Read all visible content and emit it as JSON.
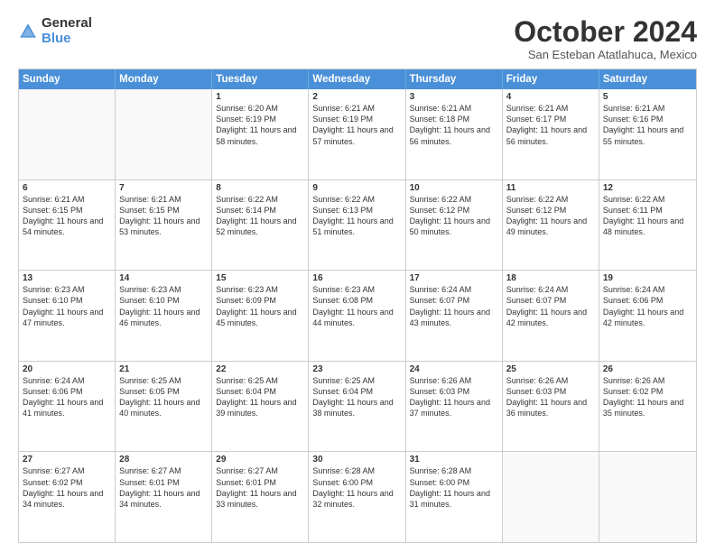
{
  "logo": {
    "general": "General",
    "blue": "Blue"
  },
  "title": "October 2024",
  "location": "San Esteban Atatlahuca, Mexico",
  "header_days": [
    "Sunday",
    "Monday",
    "Tuesday",
    "Wednesday",
    "Thursday",
    "Friday",
    "Saturday"
  ],
  "weeks": [
    [
      {
        "day": "",
        "empty": true
      },
      {
        "day": "",
        "empty": true
      },
      {
        "day": "1",
        "line1": "Sunrise: 6:20 AM",
        "line2": "Sunset: 6:19 PM",
        "line3": "Daylight: 11 hours and 58 minutes."
      },
      {
        "day": "2",
        "line1": "Sunrise: 6:21 AM",
        "line2": "Sunset: 6:19 PM",
        "line3": "Daylight: 11 hours and 57 minutes."
      },
      {
        "day": "3",
        "line1": "Sunrise: 6:21 AM",
        "line2": "Sunset: 6:18 PM",
        "line3": "Daylight: 11 hours and 56 minutes."
      },
      {
        "day": "4",
        "line1": "Sunrise: 6:21 AM",
        "line2": "Sunset: 6:17 PM",
        "line3": "Daylight: 11 hours and 56 minutes."
      },
      {
        "day": "5",
        "line1": "Sunrise: 6:21 AM",
        "line2": "Sunset: 6:16 PM",
        "line3": "Daylight: 11 hours and 55 minutes."
      }
    ],
    [
      {
        "day": "6",
        "line1": "Sunrise: 6:21 AM",
        "line2": "Sunset: 6:15 PM",
        "line3": "Daylight: 11 hours and 54 minutes."
      },
      {
        "day": "7",
        "line1": "Sunrise: 6:21 AM",
        "line2": "Sunset: 6:15 PM",
        "line3": "Daylight: 11 hours and 53 minutes."
      },
      {
        "day": "8",
        "line1": "Sunrise: 6:22 AM",
        "line2": "Sunset: 6:14 PM",
        "line3": "Daylight: 11 hours and 52 minutes."
      },
      {
        "day": "9",
        "line1": "Sunrise: 6:22 AM",
        "line2": "Sunset: 6:13 PM",
        "line3": "Daylight: 11 hours and 51 minutes."
      },
      {
        "day": "10",
        "line1": "Sunrise: 6:22 AM",
        "line2": "Sunset: 6:12 PM",
        "line3": "Daylight: 11 hours and 50 minutes."
      },
      {
        "day": "11",
        "line1": "Sunrise: 6:22 AM",
        "line2": "Sunset: 6:12 PM",
        "line3": "Daylight: 11 hours and 49 minutes."
      },
      {
        "day": "12",
        "line1": "Sunrise: 6:22 AM",
        "line2": "Sunset: 6:11 PM",
        "line3": "Daylight: 11 hours and 48 minutes."
      }
    ],
    [
      {
        "day": "13",
        "line1": "Sunrise: 6:23 AM",
        "line2": "Sunset: 6:10 PM",
        "line3": "Daylight: 11 hours and 47 minutes."
      },
      {
        "day": "14",
        "line1": "Sunrise: 6:23 AM",
        "line2": "Sunset: 6:10 PM",
        "line3": "Daylight: 11 hours and 46 minutes."
      },
      {
        "day": "15",
        "line1": "Sunrise: 6:23 AM",
        "line2": "Sunset: 6:09 PM",
        "line3": "Daylight: 11 hours and 45 minutes."
      },
      {
        "day": "16",
        "line1": "Sunrise: 6:23 AM",
        "line2": "Sunset: 6:08 PM",
        "line3": "Daylight: 11 hours and 44 minutes."
      },
      {
        "day": "17",
        "line1": "Sunrise: 6:24 AM",
        "line2": "Sunset: 6:07 PM",
        "line3": "Daylight: 11 hours and 43 minutes."
      },
      {
        "day": "18",
        "line1": "Sunrise: 6:24 AM",
        "line2": "Sunset: 6:07 PM",
        "line3": "Daylight: 11 hours and 42 minutes."
      },
      {
        "day": "19",
        "line1": "Sunrise: 6:24 AM",
        "line2": "Sunset: 6:06 PM",
        "line3": "Daylight: 11 hours and 42 minutes."
      }
    ],
    [
      {
        "day": "20",
        "line1": "Sunrise: 6:24 AM",
        "line2": "Sunset: 6:06 PM",
        "line3": "Daylight: 11 hours and 41 minutes."
      },
      {
        "day": "21",
        "line1": "Sunrise: 6:25 AM",
        "line2": "Sunset: 6:05 PM",
        "line3": "Daylight: 11 hours and 40 minutes."
      },
      {
        "day": "22",
        "line1": "Sunrise: 6:25 AM",
        "line2": "Sunset: 6:04 PM",
        "line3": "Daylight: 11 hours and 39 minutes."
      },
      {
        "day": "23",
        "line1": "Sunrise: 6:25 AM",
        "line2": "Sunset: 6:04 PM",
        "line3": "Daylight: 11 hours and 38 minutes."
      },
      {
        "day": "24",
        "line1": "Sunrise: 6:26 AM",
        "line2": "Sunset: 6:03 PM",
        "line3": "Daylight: 11 hours and 37 minutes."
      },
      {
        "day": "25",
        "line1": "Sunrise: 6:26 AM",
        "line2": "Sunset: 6:03 PM",
        "line3": "Daylight: 11 hours and 36 minutes."
      },
      {
        "day": "26",
        "line1": "Sunrise: 6:26 AM",
        "line2": "Sunset: 6:02 PM",
        "line3": "Daylight: 11 hours and 35 minutes."
      }
    ],
    [
      {
        "day": "27",
        "line1": "Sunrise: 6:27 AM",
        "line2": "Sunset: 6:02 PM",
        "line3": "Daylight: 11 hours and 34 minutes."
      },
      {
        "day": "28",
        "line1": "Sunrise: 6:27 AM",
        "line2": "Sunset: 6:01 PM",
        "line3": "Daylight: 11 hours and 34 minutes."
      },
      {
        "day": "29",
        "line1": "Sunrise: 6:27 AM",
        "line2": "Sunset: 6:01 PM",
        "line3": "Daylight: 11 hours and 33 minutes."
      },
      {
        "day": "30",
        "line1": "Sunrise: 6:28 AM",
        "line2": "Sunset: 6:00 PM",
        "line3": "Daylight: 11 hours and 32 minutes."
      },
      {
        "day": "31",
        "line1": "Sunrise: 6:28 AM",
        "line2": "Sunset: 6:00 PM",
        "line3": "Daylight: 11 hours and 31 minutes."
      },
      {
        "day": "",
        "empty": true
      },
      {
        "day": "",
        "empty": true
      }
    ]
  ]
}
